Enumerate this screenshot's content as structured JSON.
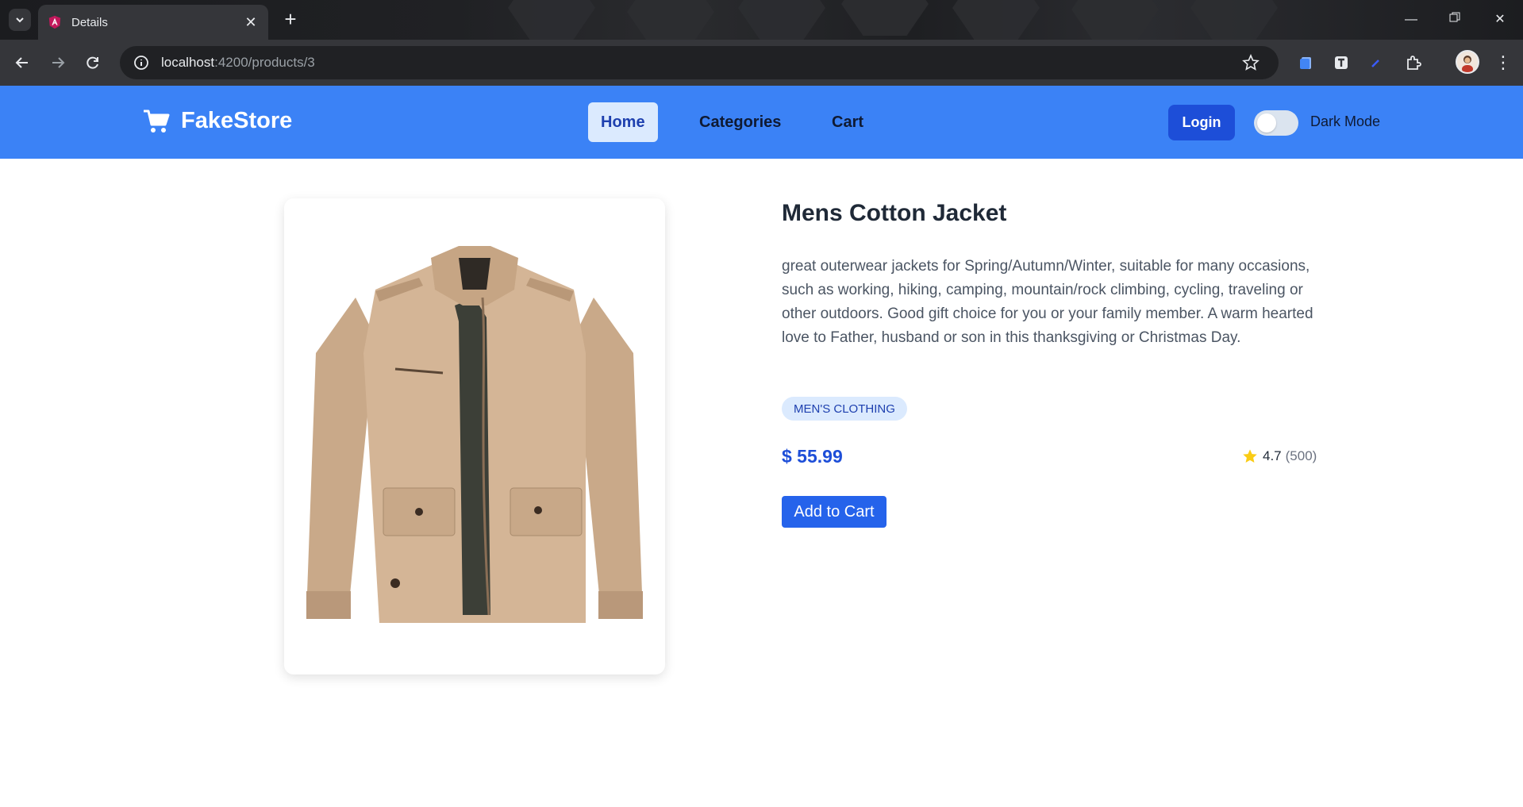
{
  "browser": {
    "tab_title": "Details",
    "url_host": "localhost",
    "url_path": ":4200/products/3",
    "window_controls": [
      "minimize-icon",
      "restore-icon",
      "close-icon"
    ]
  },
  "navbar": {
    "brand": "FakeStore",
    "links": [
      "Home",
      "Categories",
      "Cart"
    ],
    "active_link": "Home",
    "login_label": "Login",
    "dark_mode_label": "Dark Mode",
    "dark_mode_on": false,
    "colors": {
      "background": "#3b82f6",
      "login": "#1d4ed8"
    }
  },
  "product": {
    "title": "Mens Cotton Jacket",
    "description": "great outerwear jackets for Spring/Autumn/Winter, suitable for many occasions, such as working, hiking, camping, mountain/rock climbing, cycling, traveling or other outdoors. Good gift choice for you or your family member. A warm hearted love to Father, husband or son in this thanksgiving or Christmas Day.",
    "category": "MEN'S CLOTHING",
    "price": "$ 55.99",
    "rating": "4.7",
    "rating_count": "(500)",
    "add_to_cart_label": "Add to Cart",
    "image_icon": "jacket-image"
  }
}
